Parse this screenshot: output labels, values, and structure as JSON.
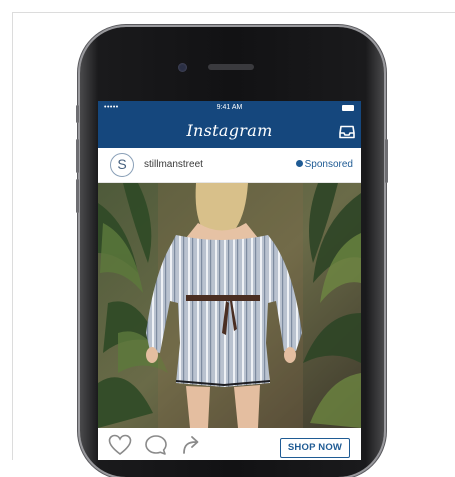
{
  "status_bar": {
    "signal": "•••••",
    "time": "9:41 AM",
    "battery_icon": "battery-icon"
  },
  "app": {
    "title": "Instagram",
    "brand_color": "#15477d",
    "inbox_icon": "inbox-icon"
  },
  "post": {
    "avatar_letter": "S",
    "username": "stillmanstreet",
    "sponsored_label": "Sponsored",
    "image_description_icon": "fashion-photo",
    "actions": {
      "like_icon": "heart-icon",
      "comment_icon": "comment-icon",
      "share_icon": "share-icon",
      "cta_label": "SHOP NOW"
    }
  }
}
